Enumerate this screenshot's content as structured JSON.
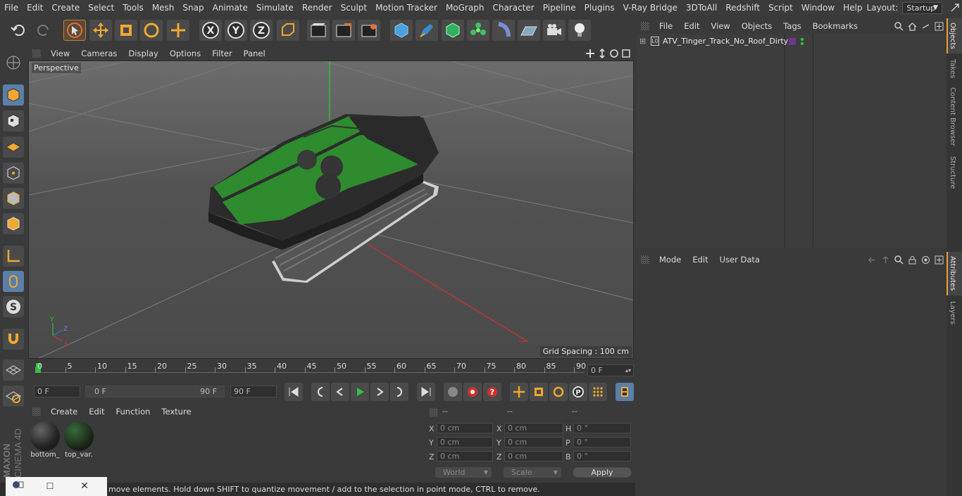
{
  "menubar": {
    "items": [
      "File",
      "Edit",
      "Create",
      "Select",
      "Tools",
      "Mesh",
      "Snap",
      "Animate",
      "Simulate",
      "Render",
      "Sculpt",
      "Motion Tracker",
      "MoGraph",
      "Character",
      "Pipeline",
      "Plugins",
      "V-Ray Bridge",
      "3DToAll",
      "Redshift",
      "Script",
      "Window",
      "Help"
    ],
    "layout_label": "Layout:",
    "layout_value": "Startup"
  },
  "toolbar": {
    "icons": [
      "undo-icon",
      "redo-icon",
      "select-icon",
      "move-icon",
      "scale-icon",
      "rotate-icon",
      "transform-icon",
      "x-axis-icon",
      "y-axis-icon",
      "z-axis-icon",
      "coordinate-system-icon",
      "render-view-icon",
      "render-picture-queue-icon",
      "render-settings-icon",
      "cube-icon",
      "pen-icon",
      "subdivision-icon",
      "cloner-icon",
      "deformer-icon",
      "floor-icon",
      "camera-icon",
      "light-icon"
    ],
    "x": "X",
    "y": "Y",
    "z": "Z"
  },
  "viewport": {
    "menu": [
      "View",
      "Cameras",
      "Display",
      "Options",
      "Filter",
      "Panel"
    ],
    "label": "Perspective",
    "grid_spacing": "Grid Spacing : 100 cm"
  },
  "timeline": {
    "ticks": [
      "0",
      "5",
      "10",
      "15",
      "20",
      "25",
      "30",
      "35",
      "40",
      "45",
      "50",
      "55",
      "60",
      "65",
      "70",
      "75",
      "80",
      "85",
      "90"
    ],
    "current_frame": "0 F"
  },
  "playback": {
    "start": "0 F",
    "range_start": "0 F",
    "range_end": "90 F",
    "end": "90 F"
  },
  "material_manager": {
    "menu": [
      "Create",
      "Edit",
      "Function",
      "Texture"
    ],
    "materials": [
      {
        "name": "bottom_"
      },
      {
        "name": "top_var."
      }
    ]
  },
  "coordinates": {
    "headers": [
      "--",
      "--",
      "--"
    ],
    "rows": [
      {
        "l1": "X",
        "v1": "0 cm",
        "l2": "X",
        "v2": "0 cm",
        "l3": "H",
        "v3": "0 °"
      },
      {
        "l1": "Y",
        "v1": "0 cm",
        "l2": "Y",
        "v2": "0 cm",
        "l3": "P",
        "v3": "0 °"
      },
      {
        "l1": "Z",
        "v1": "0 cm",
        "l2": "Z",
        "v2": "0 cm",
        "l3": "B",
        "v3": "0 °"
      }
    ],
    "mode1": "World",
    "mode2": "Scale",
    "apply": "Apply"
  },
  "statusbar": {
    "text": "move elements. Hold down SHIFT to quantize movement / add to the selection in point mode, CTRL to remove."
  },
  "object_manager": {
    "menu": [
      "File",
      "Edit",
      "View",
      "Objects",
      "Tags",
      "Bookmarks"
    ],
    "objects": [
      {
        "name": "ATV_Tinger_Track_No_Roof_Dirty",
        "layer_color": "#6a3a8a"
      }
    ]
  },
  "attribute_manager": {
    "menu": [
      "Mode",
      "Edit",
      "User Data"
    ]
  },
  "right_tabs": [
    "Objects",
    "Takes",
    "Content Browser",
    "Structure",
    "Attributes",
    "Layers"
  ],
  "branding": {
    "vendor": "MAXON",
    "product": "CINEMA 4D"
  },
  "colors": {
    "accent": "#e8a030",
    "green_model": "#2e8b2e",
    "axis_red": "#d03030",
    "axis_green": "#30c030"
  }
}
